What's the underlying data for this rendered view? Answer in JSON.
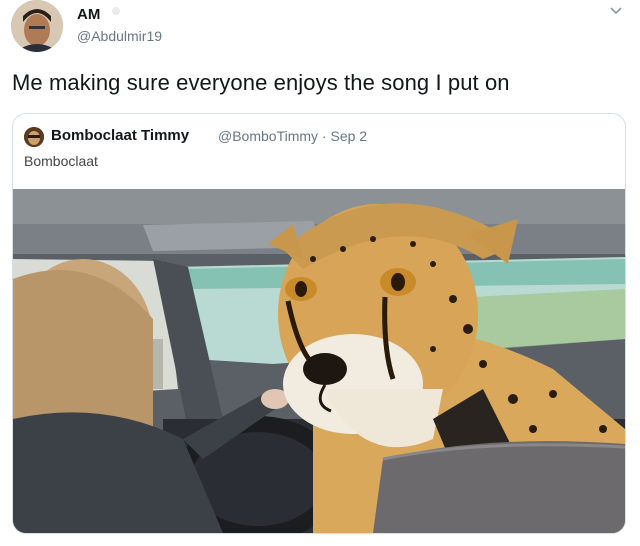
{
  "tweet": {
    "author_name": "AM",
    "author_handle": "@Abdulmir19",
    "text": "Me making sure everyone enjoys the song I put on"
  },
  "quoted_tweet": {
    "author_name": "Bombocl­aat Timmy",
    "author_handle": "@BomboTimmy · Sep 2",
    "text": "Bomboclaat"
  },
  "icons": {
    "menu": "chevron-down-icon",
    "verified": "verified-badge-icon"
  }
}
